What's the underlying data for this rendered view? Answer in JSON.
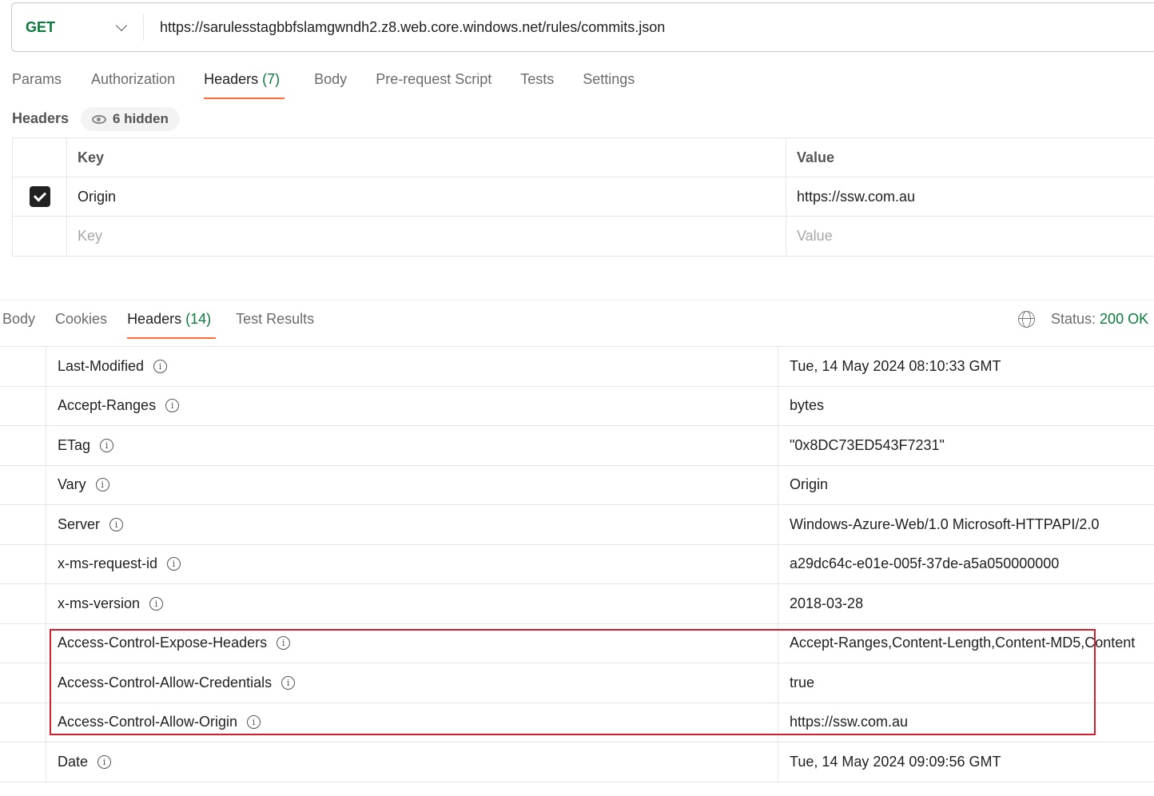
{
  "request": {
    "method": "GET",
    "url": "https://sarulesstagbbfslamgwndh2.z8.web.core.windows.net/rules/commits.json"
  },
  "request_tabs": [
    {
      "label": "Params"
    },
    {
      "label": "Authorization"
    },
    {
      "label": "Headers",
      "count": "(7)"
    },
    {
      "label": "Body"
    },
    {
      "label": "Pre-request Script"
    },
    {
      "label": "Tests"
    },
    {
      "label": "Settings"
    }
  ],
  "headers_section": {
    "label": "Headers",
    "hidden": "6 hidden",
    "col_key": "Key",
    "col_value": "Value",
    "rows": [
      {
        "key": "Origin",
        "value": "https://ssw.com.au",
        "checked": true
      }
    ],
    "placeholder_key": "Key",
    "placeholder_value": "Value"
  },
  "response_tabs": [
    {
      "label": "Body"
    },
    {
      "label": "Cookies"
    },
    {
      "label": "Headers",
      "count": "(14)"
    },
    {
      "label": "Test Results"
    }
  ],
  "status": {
    "label": "Status:",
    "value": "200 OK",
    "color": "#0b7a3b"
  },
  "response_headers": [
    {
      "key": "Last-Modified",
      "value": "Tue, 14 May 2024 08:10:33 GMT"
    },
    {
      "key": "Accept-Ranges",
      "value": "bytes"
    },
    {
      "key": "ETag",
      "value": "\"0x8DC73ED543F7231\""
    },
    {
      "key": "Vary",
      "value": "Origin"
    },
    {
      "key": "Server",
      "value": "Windows-Azure-Web/1.0 Microsoft-HTTPAPI/2.0"
    },
    {
      "key": "x-ms-request-id",
      "value": "a29dc64c-e01e-005f-37de-a5a050000000"
    },
    {
      "key": "x-ms-version",
      "value": "2018-03-28"
    },
    {
      "key": "Access-Control-Expose-Headers",
      "value": "Accept-Ranges,Content-Length,Content-MD5,Content"
    },
    {
      "key": "Access-Control-Allow-Credentials",
      "value": "true"
    },
    {
      "key": "Access-Control-Allow-Origin",
      "value": "https://ssw.com.au"
    },
    {
      "key": "Date",
      "value": "Tue, 14 May 2024 09:09:56 GMT"
    }
  ],
  "highlight_color": "#d0202e"
}
